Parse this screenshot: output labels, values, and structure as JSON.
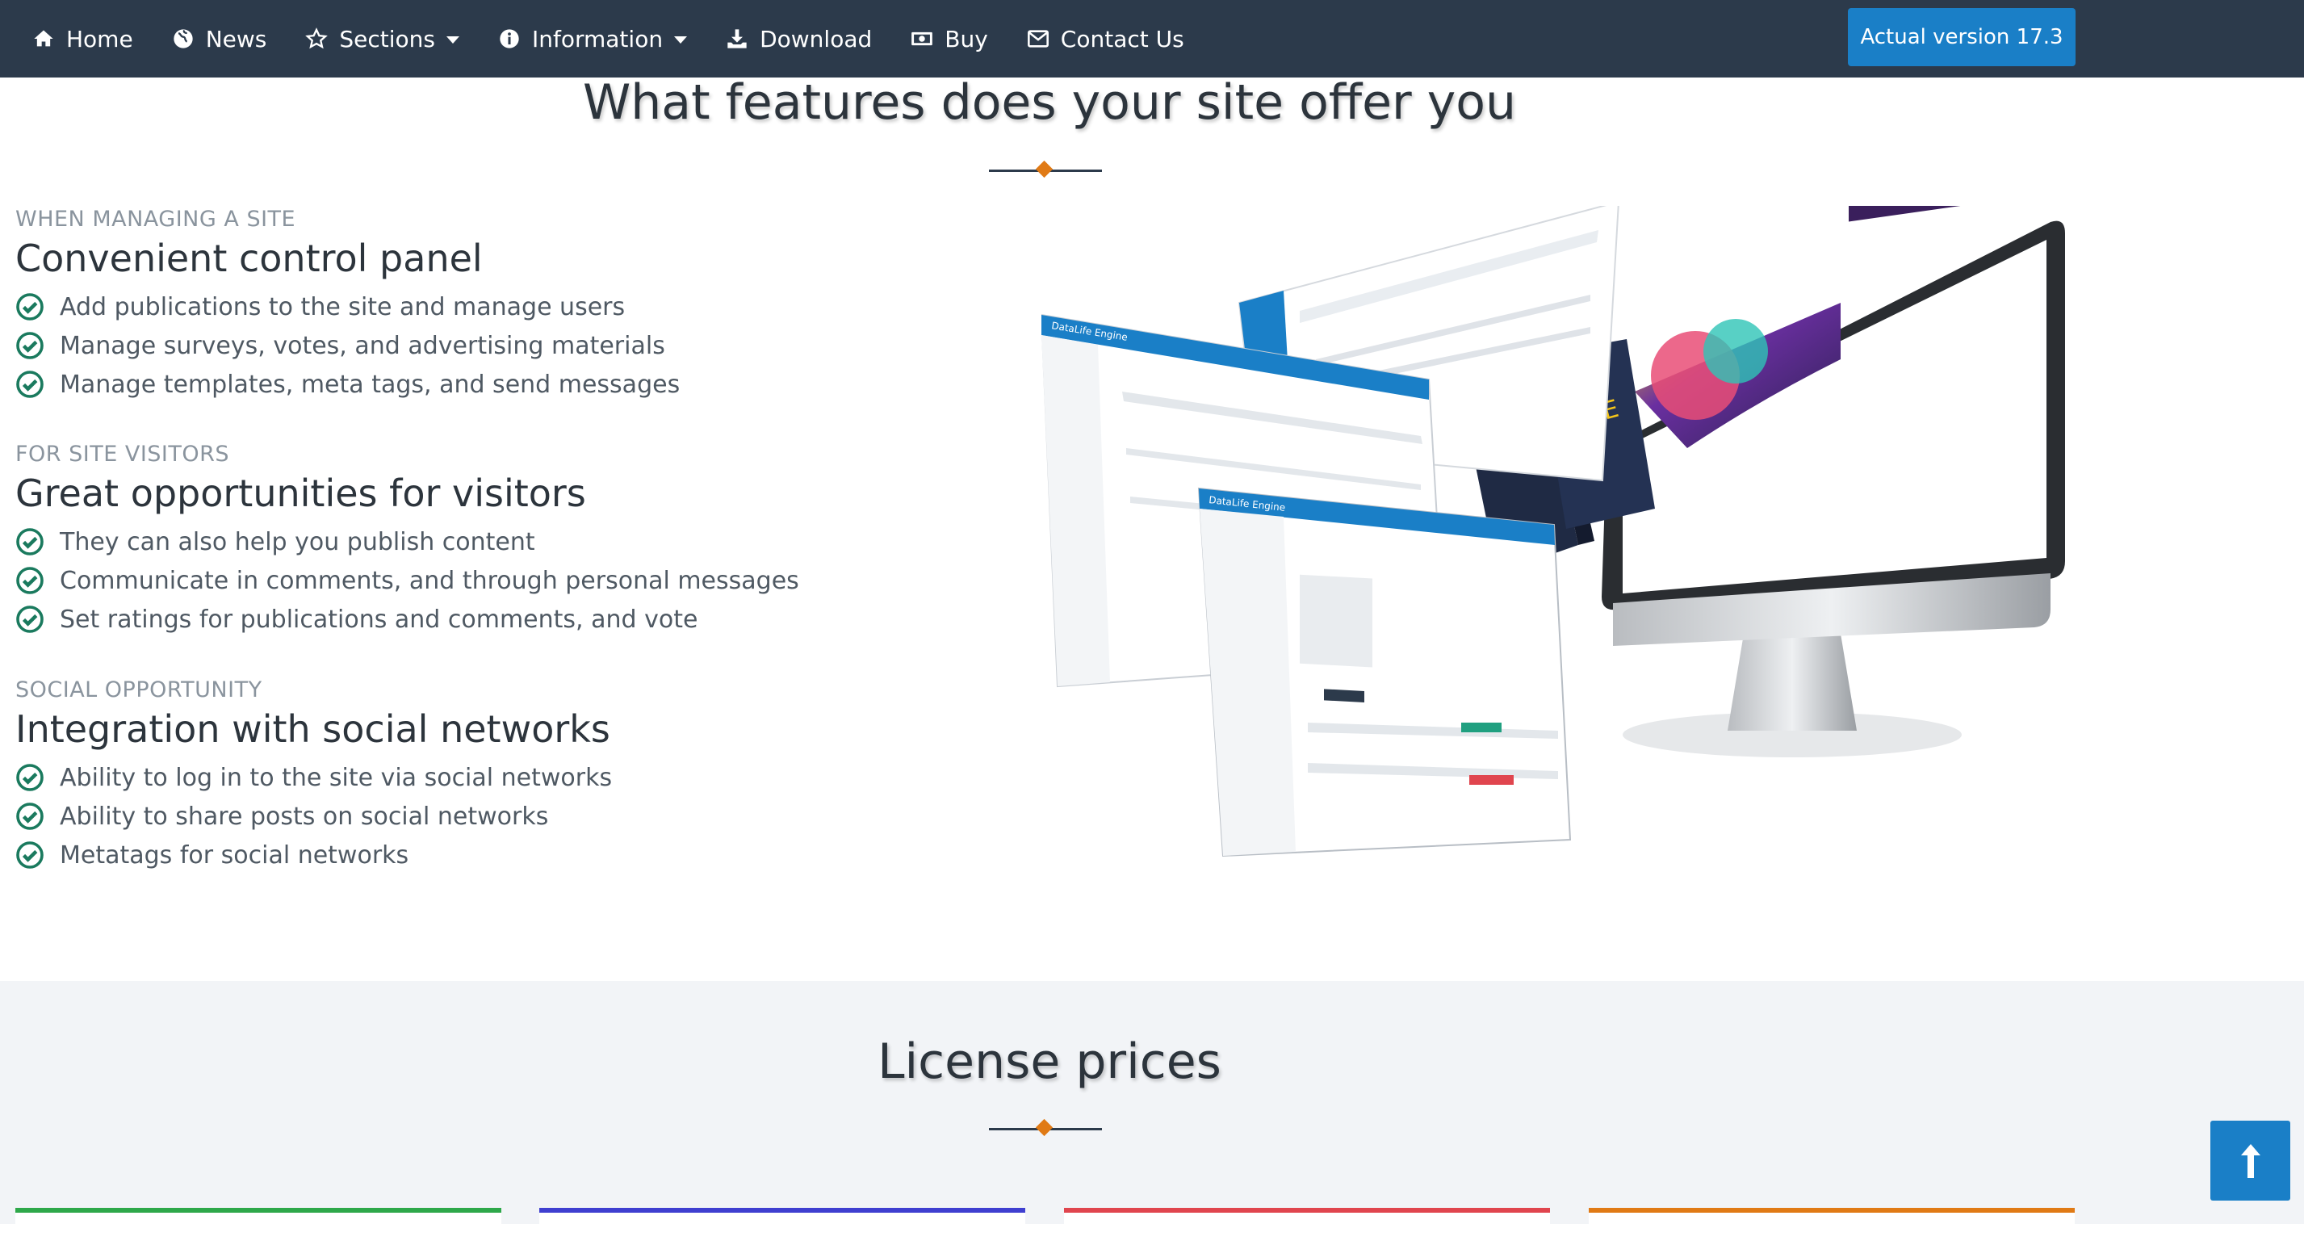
{
  "nav": {
    "items": [
      {
        "label": "Home",
        "icon": "home-icon"
      },
      {
        "label": "News",
        "icon": "globe-icon"
      },
      {
        "label": "Sections",
        "icon": "star-icon"
      },
      {
        "label": "Information",
        "icon": "info-icon"
      },
      {
        "label": "Download",
        "icon": "download-icon"
      },
      {
        "label": "Buy",
        "icon": "money-icon"
      },
      {
        "label": "Contact Us",
        "icon": "envelope-icon"
      }
    ],
    "version_button": "Actual version 17.3"
  },
  "features": {
    "title": "What features does your site offer you",
    "groups": [
      {
        "label": "WHEN MANAGING A SITE",
        "title": "Convenient control panel",
        "items": [
          "Add publications to the site and manage users",
          "Manage surveys, votes, and advertising materials",
          "Manage templates, meta tags, and send messages"
        ]
      },
      {
        "label": "FOR SITE VISITORS",
        "title": "Great opportunities for visitors",
        "items": [
          "They can also help you publish content",
          "Communicate in comments, and through personal messages",
          "Set ratings for publications and comments, and vote"
        ]
      },
      {
        "label": "SOCIAL OPPORTUNITY",
        "title": "Integration with social networks",
        "items": [
          "Ability to log in to the site via social networks",
          "Ability to share posts on social networks",
          "Metatags for social networks"
        ]
      }
    ]
  },
  "hero_image": {
    "panel_brand": "DataLife Engine",
    "box_logo": "DLE"
  },
  "license": {
    "title": "License prices",
    "card_colors": [
      "#2ea84a",
      "#3f3fd0",
      "#e0454e",
      "#e07a15"
    ]
  },
  "colors": {
    "navbar": "#2c3a4b",
    "accent": "#1a7fc7",
    "check": "#1a7a5e",
    "divider_diamond": "#e07a15"
  }
}
